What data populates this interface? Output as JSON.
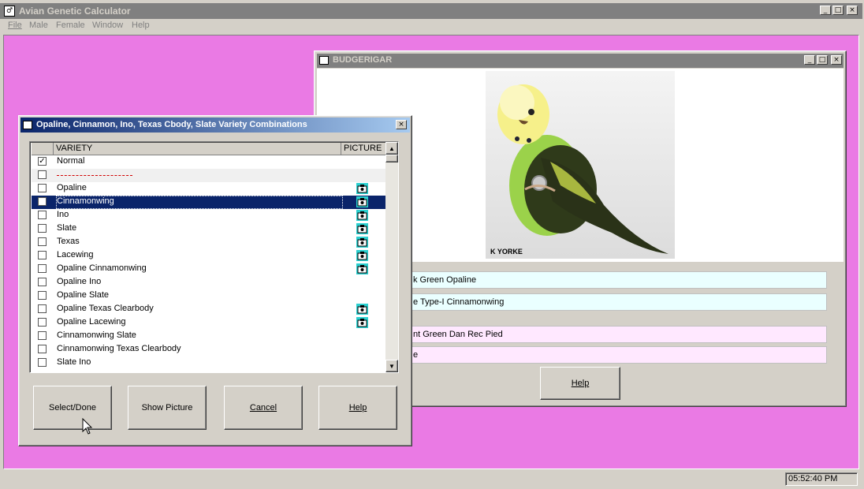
{
  "app": {
    "title": "Avian Genetic Calculator",
    "menu": [
      "File",
      "Male",
      "Female",
      "Window",
      "Help"
    ],
    "status_time": "05:52:40 PM",
    "colors": {
      "desktop": "#ea7ae4",
      "titlebar_inactive": "#808080",
      "selection": "#0a246a"
    }
  },
  "budgie_window": {
    "title": "BUDGERIGAR",
    "photo_caption": "K YORKE",
    "fields": [
      "k Green Opaline",
      "e Type-I Cinnamonwing",
      "nt Green Dan Rec Pied",
      "e"
    ],
    "help_label": "Help"
  },
  "dialog": {
    "title": "Opaline, Cinnamon, Ino, Texas Cbody, Slate Variety Combinations",
    "headers": {
      "variety": "VARIETY",
      "picture": "PICTURE"
    },
    "rows": [
      {
        "label": "Normal",
        "checked": true,
        "picture": false
      },
      {
        "label": "",
        "separator": true
      },
      {
        "label": "Opaline",
        "checked": false,
        "picture": true
      },
      {
        "label": "Cinnamonwing",
        "checked": false,
        "picture": true,
        "selected": true
      },
      {
        "label": "Ino",
        "checked": false,
        "picture": true
      },
      {
        "label": "Slate",
        "checked": false,
        "picture": true
      },
      {
        "label": "Texas",
        "checked": false,
        "picture": true
      },
      {
        "label": "Lacewing",
        "checked": false,
        "picture": true
      },
      {
        "label": "Opaline Cinnamonwing",
        "checked": false,
        "picture": true
      },
      {
        "label": "Opaline Ino",
        "checked": false,
        "picture": false
      },
      {
        "label": "Opaline Slate",
        "checked": false,
        "picture": false
      },
      {
        "label": "Opaline Texas Clearbody",
        "checked": false,
        "picture": true
      },
      {
        "label": "Opaline Lacewing",
        "checked": false,
        "picture": true
      },
      {
        "label": "Cinnamonwing Slate",
        "checked": false,
        "picture": false
      },
      {
        "label": "Cinnamonwing Texas Clearbody",
        "checked": false,
        "picture": false
      },
      {
        "label": "Slate Ino",
        "checked": false,
        "picture": false
      }
    ],
    "buttons": {
      "select_done": "Select/Done",
      "show_picture": "Show Picture",
      "cancel": "Cancel",
      "help": "Help"
    }
  }
}
